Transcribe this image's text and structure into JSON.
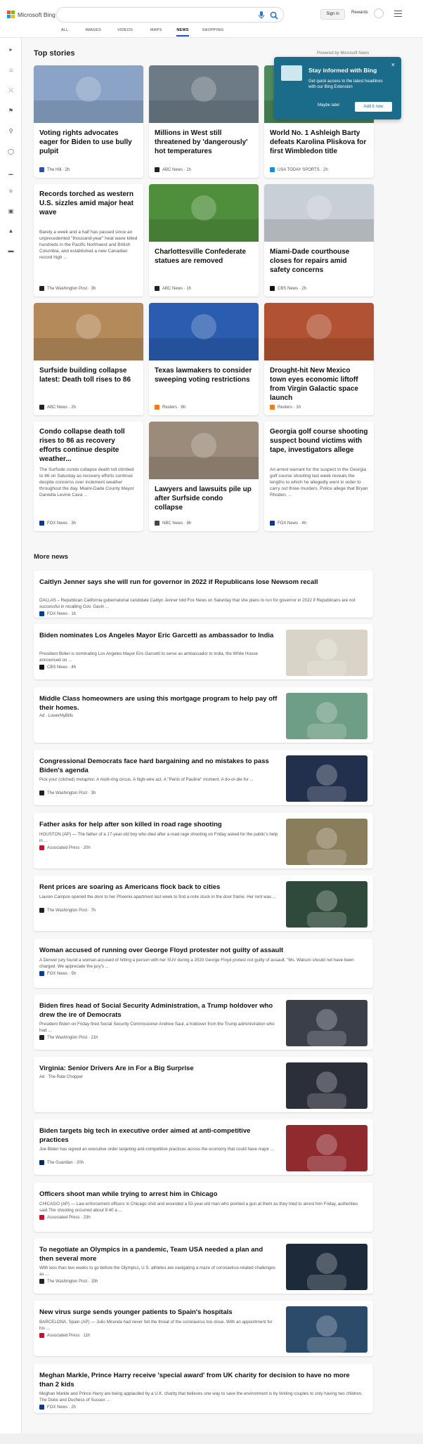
{
  "header": {
    "logo": "Microsoft Bing",
    "search_placeholder": "",
    "sign_in": "Sign in",
    "rewards": "Rewards"
  },
  "tabs": [
    "ALL",
    "IMAGES",
    "VIDEOS",
    "MAPS",
    "NEWS",
    "SHOPPING"
  ],
  "top_stories": {
    "heading": "Top stories",
    "powered": "Powered by Microsoft News",
    "cards": [
      {
        "title": "Voting rights advocates eager for Biden to use bully pulpit",
        "snippet": "",
        "source": "The Hill",
        "time": "2h"
      },
      {
        "title": "Millions in West still threatened by 'dangerously' hot temperatures",
        "snippet": "",
        "source": "ABC News",
        "time": "1h"
      },
      {
        "title": "World No. 1 Ashleigh Barty defeats Karolina Pliskova for first Wimbledon title",
        "snippet": "",
        "source": "USA TODAY SPORTS",
        "time": "2h"
      },
      {
        "title": "Records torched as western U.S. sizzles amid major heat wave",
        "snippet": "Barely a week and a half has passed since an unprecedented \"thousand-year\" heat wave killed hundreds in the Pacific Northwest and British Columbia, and established a new Canadian record high ...",
        "source": "The Washington Post",
        "time": "3h"
      },
      {
        "title": "Charlottesville Confederate statues are removed",
        "snippet": "",
        "source": "ABC News",
        "time": "1h"
      },
      {
        "title": "Miami-Dade courthouse closes for repairs amid safety concerns",
        "snippet": "",
        "source": "CBS News",
        "time": "2h"
      },
      {
        "title": "Surfside building collapse latest: Death toll rises to 86",
        "snippet": "",
        "source": "ABC News",
        "time": "2h"
      },
      {
        "title": "Texas lawmakers to consider sweeping voting restrictions",
        "snippet": "",
        "source": "Reuters",
        "time": "8h"
      },
      {
        "title": "Drought-hit New Mexico town eyes economic liftoff from Virgin Galactic space launch",
        "snippet": "",
        "source": "Reuters",
        "time": "1h"
      },
      {
        "title": "Condo collapse death toll rises to 86 as recovery efforts continue despite weather...",
        "snippet": "The Surfside condo collapse death toll climbed to 86 on Saturday as recovery efforts continue despite concerns over inclement weather throughout the day. Miami-Dade County Mayor Daniella Levine Cava ...",
        "source": "FOX News",
        "time": "3h"
      },
      {
        "title": "Lawyers and lawsuits pile up after Surfside condo collapse",
        "snippet": "",
        "source": "NBC News",
        "time": "8h"
      },
      {
        "title": "Georgia golf course shooting suspect bound victims with tape, investigators allege",
        "snippet": "An arrest warrant for the suspect in the Georgia golf course shooting last week reveals the lengths to which he allegedly went in order to carry out three murders. Police allege that Bryan Rhoden, ...",
        "source": "FOX News",
        "time": "4h"
      }
    ]
  },
  "popup": {
    "title": "Stay informed with Bing",
    "desc": "Get quick access to the latest headlines with our Bing Extension",
    "maybe_later": "Maybe later",
    "add": "Add it now",
    "close": "×"
  },
  "more_news": {
    "heading": "More news",
    "items": [
      {
        "title": "Caitlyn Jenner says she will run for governor in 2022 if Republicans lose Newsom recall",
        "snippet": "DALLAS – Republican California gubernatorial candidate Caitlyn Jenner told Fox News on Saturday that she plans to run for governor in 2022 if Republicans are not successful in recalling Gov. Gavin ...",
        "source": "FOX News",
        "time": "1h"
      },
      {
        "title": "Biden nominates Los Angeles Mayor Eric Garcetti as ambassador to India",
        "snippet": "President Biden is nominating Los Angeles Mayor Eric Garcetti to serve as ambassador to India, the White House announced on ...",
        "source": "CBS News",
        "time": "4h"
      },
      {
        "title": "Middle Class homeowners are using this mortgage program to help pay off their homes.",
        "snippet": "",
        "source": "Ad · LowerMyBills",
        "time": ""
      },
      {
        "title": "Congressional Democrats face hard bargaining and no mistakes to pass Biden's agenda",
        "snippet": "Pick your (cliched) metaphor. A multi-ring circus. A high-wire act. A \"Perils of Pauline\" moment. A do-or-die for ...",
        "source": "The Washington Post",
        "time": "3h"
      },
      {
        "title": "Father asks for help after son killed in road rage shooting",
        "snippet": "HOUSTON (AP) — The father of a 17-year-old boy who died after a road rage shooting on Friday asked for the public's help in ...",
        "source": "Associated Press",
        "time": "20h"
      },
      {
        "title": "Rent prices are soaring as Americans flock back to cities",
        "snippet": "Lauren Campos opened the door to her Phoenix apartment last week to find a note stuck in the door frame. Her rent was ...",
        "source": "The Washington Post",
        "time": "7h"
      },
      {
        "title": "Woman accused of running over George Floyd protester not guilty of assault",
        "snippet": "A Denver jury found a woman accused of hitting a person with her SUV during a 2020 George Floyd protest not guilty of assault. \"Ms. Watson should not have been charged. We appreciate the jury's ...",
        "source": "FOX News",
        "time": "5h"
      },
      {
        "title": "Biden fires head of Social Security Administration, a Trump holdover who drew the ire of Democrats",
        "snippet": "President Biden on Friday fired Social Security Commissioner Andrew Saul, a holdover from the Trump administration who had ...",
        "source": "The Washington Post",
        "time": "21h"
      },
      {
        "title": "Virginia: Senior Drivers Are in For a Big Surprise",
        "snippet": "",
        "source": "Ad · The Rate Chopper",
        "time": ""
      },
      {
        "title": "Biden targets big tech in executive order aimed at anti-competitive practices",
        "snippet": "Joe Biden has signed an executive order targeting anti-competitive practices across the economy that could have major ...",
        "source": "The Guardian",
        "time": "20h"
      },
      {
        "title": "Officers shoot man while trying to arrest him in Chicago",
        "snippet": "CHICAGO (AP) — Law enforcement officers in Chicago shot and wounded a 53-year-old man who pointed a gun at them as they tried to arrest him Friday, authorities said.The shooting occurred about 9:40 a ...",
        "source": "Associated Press",
        "time": "23h"
      },
      {
        "title": "To negotiate an Olympics in a pandemic, Team USA needed a plan and then several more",
        "snippet": "With less than two weeks to go before the Olympics, U.S. athletes are navigating a maze of coronavirus-related challenges as ...",
        "source": "The Washington Post",
        "time": "15h"
      },
      {
        "title": "New virus surge sends younger patients to Spain's hospitals",
        "snippet": "BARCELONA, Spain (AP) — Julio Miranda had never felt the threat of the coronavirus too close. With an appointment for his ...",
        "source": "Associated Press",
        "time": "11h"
      },
      {
        "title": "Meghan Markle, Prince Harry receive 'special award' from UK charity for decision to have no more than 2 kids",
        "snippet": "Meghan Markle and Prince Harry are being applauded by a U.K. charity that believes one way to save the environment is by limiting couples to only having two children. The Duke and Duchess of Sussex ...",
        "source": "FOX News",
        "time": "2h"
      }
    ]
  }
}
